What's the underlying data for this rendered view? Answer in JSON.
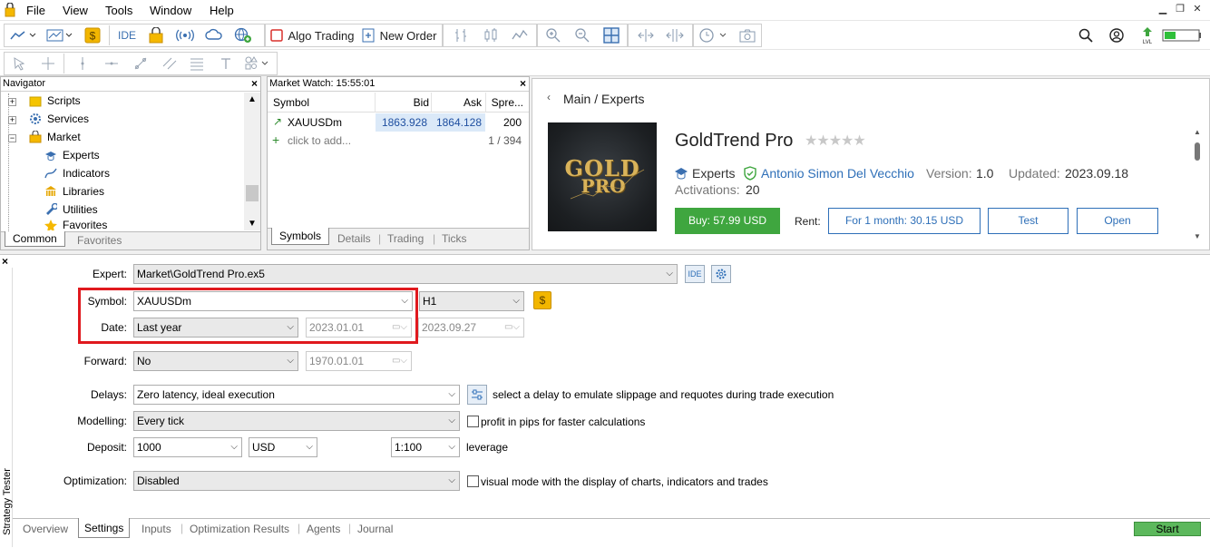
{
  "menu": {
    "items": [
      "File",
      "View",
      "Tools",
      "Window",
      "Help"
    ]
  },
  "toolbar": {
    "ide_label": "IDE",
    "algo_label": "Algo Trading",
    "order_label": "New Order"
  },
  "navigator": {
    "title": "Navigator",
    "items": [
      {
        "label": "Scripts",
        "icon": "folder-icon"
      },
      {
        "label": "Services",
        "icon": "services-icon"
      },
      {
        "label": "Market",
        "icon": "market-icon"
      },
      {
        "label": "Experts",
        "icon": "experts-icon"
      },
      {
        "label": "Indicators",
        "icon": "indicators-icon"
      },
      {
        "label": "Libraries",
        "icon": "libraries-icon"
      },
      {
        "label": "Utilities",
        "icon": "utilities-icon"
      },
      {
        "label": "Favorites",
        "icon": "favorites-icon"
      }
    ],
    "tabs": [
      "Common",
      "Favorites"
    ]
  },
  "market_watch": {
    "title": "Market Watch: 15:55:01",
    "headers": [
      "Symbol",
      "Bid",
      "Ask",
      "Spre..."
    ],
    "rows": [
      {
        "symbol": "XAUUSDm",
        "bid": "1863.928",
        "ask": "1864.128",
        "spread": "200"
      }
    ],
    "add_label": "click to add...",
    "count": "1 / 394",
    "tabs": [
      "Symbols",
      "Details",
      "Trading",
      "Ticks"
    ]
  },
  "market": {
    "breadcrumb": "Main / Experts",
    "title": "GoldTrend Pro",
    "logo_line1": "GOLD",
    "logo_line2": "PRO",
    "category": "Experts",
    "author": "Antonio Simon Del Vecchio",
    "version_label": "Version:",
    "version": "1.0",
    "updated_label": "Updated:",
    "updated": "2023.09.18",
    "activations_label": "Activations:",
    "activations": "20",
    "buy_label": "Buy: 57.99 USD",
    "rent_label": "Rent:",
    "rent_option": "For 1 month: 30.15 USD",
    "test_label": "Test",
    "open_label": "Open",
    "rating": 0
  },
  "tester": {
    "side_label": "Strategy Tester",
    "expert_label": "Expert:",
    "expert_value": "Market\\GoldTrend Pro.ex5",
    "ide_label": "IDE",
    "symbol_label": "Symbol:",
    "symbol_value": "XAUUSDm",
    "timeframe": "H1",
    "date_label": "Date:",
    "date_value": "Last year",
    "date_from": "2023.01.01",
    "date_to": "2023.09.27",
    "forward_label": "Forward:",
    "forward_value": "No",
    "forward_date": "1970.01.01",
    "delays_label": "Delays:",
    "delays_value": "Zero latency, ideal execution",
    "delays_hint": "select a delay to emulate slippage and requotes during trade execution",
    "modelling_label": "Modelling:",
    "modelling_value": "Every tick",
    "pips_hint": "profit in pips for faster calculations",
    "deposit_label": "Deposit:",
    "deposit_value": "1000",
    "currency": "USD",
    "leverage_value": "1:100",
    "leverage_label": "leverage",
    "optimization_label": "Optimization:",
    "optimization_value": "Disabled",
    "visual_hint": "visual mode with the display of charts, indicators and trades",
    "tabs": [
      "Overview",
      "Settings",
      "Inputs",
      "Optimization Results",
      "Agents",
      "Journal"
    ],
    "start_label": "Start"
  },
  "colors": {
    "accent": "#2e6fb8",
    "buy": "#3fa63f",
    "highlight": "#e0191e",
    "start": "#5cb85c"
  }
}
